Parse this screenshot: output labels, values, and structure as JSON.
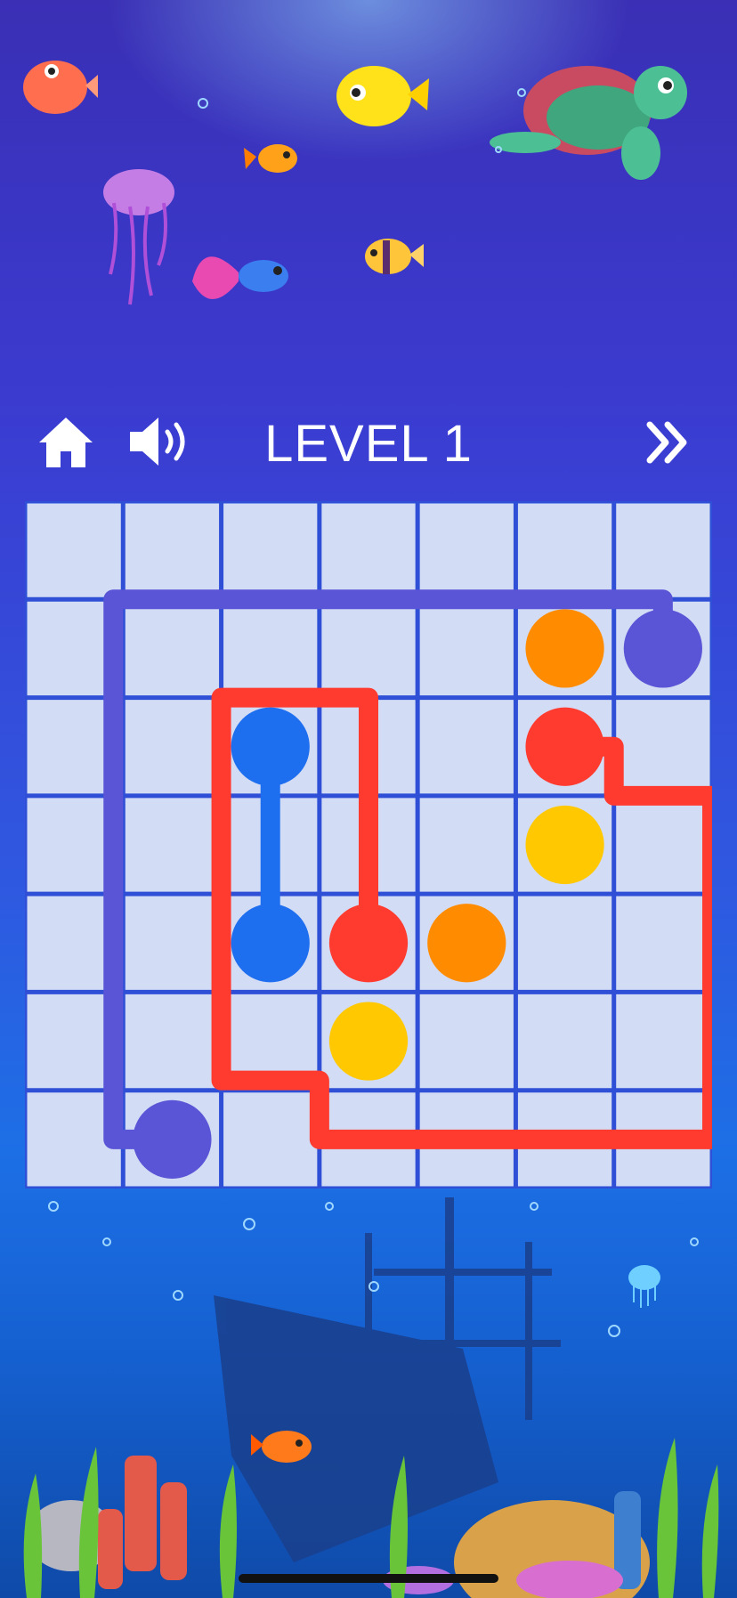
{
  "header": {
    "level_label": "LEVEL 1",
    "home_icon": "home-icon",
    "sound_icon": "speaker-icon",
    "next_icon": "double-chevron-right-icon"
  },
  "board": {
    "rows": 7,
    "cols": 7,
    "colors": {
      "purple": "#5a55d6",
      "blue": "#1e6ef0",
      "red": "#ff3a2e",
      "orange": "#ff8c00",
      "yellow": "#ffc800",
      "cell": "#d2dcf5",
      "grid": "#2f4fd6"
    },
    "dots": [
      {
        "color": "purple",
        "row": 1,
        "col": 6
      },
      {
        "color": "purple",
        "row": 6,
        "col": 1
      },
      {
        "color": "orange",
        "row": 1,
        "col": 5
      },
      {
        "color": "orange",
        "row": 4,
        "col": 4
      },
      {
        "color": "red",
        "row": 2,
        "col": 5
      },
      {
        "color": "red",
        "row": 4,
        "col": 3
      },
      {
        "color": "blue",
        "row": 2,
        "col": 2
      },
      {
        "color": "blue",
        "row": 4,
        "col": 2
      },
      {
        "color": "yellow",
        "row": 3,
        "col": 5
      },
      {
        "color": "yellow",
        "row": 5,
        "col": 3
      }
    ],
    "paths": [
      {
        "color": "purple",
        "points": [
          [
            1,
            6
          ],
          [
            0.5,
            6
          ],
          [
            0.5,
            0.4
          ],
          [
            6,
            0.4
          ],
          [
            6,
            1
          ]
        ]
      },
      {
        "color": "blue",
        "points": [
          [
            2,
            2
          ],
          [
            4,
            2
          ]
        ]
      },
      {
        "color": "red",
        "points": [
          [
            4,
            3
          ],
          [
            1.5,
            3
          ],
          [
            1.5,
            1.5
          ],
          [
            5.4,
            1.5
          ],
          [
            5.4,
            2.5
          ],
          [
            6,
            2.5
          ],
          [
            6,
            6.5
          ],
          [
            2.5,
            6.5
          ],
          [
            2.5,
            5.5
          ],
          [
            2,
            5.5
          ],
          [
            2,
            5.3
          ]
        ]
      }
    ]
  }
}
